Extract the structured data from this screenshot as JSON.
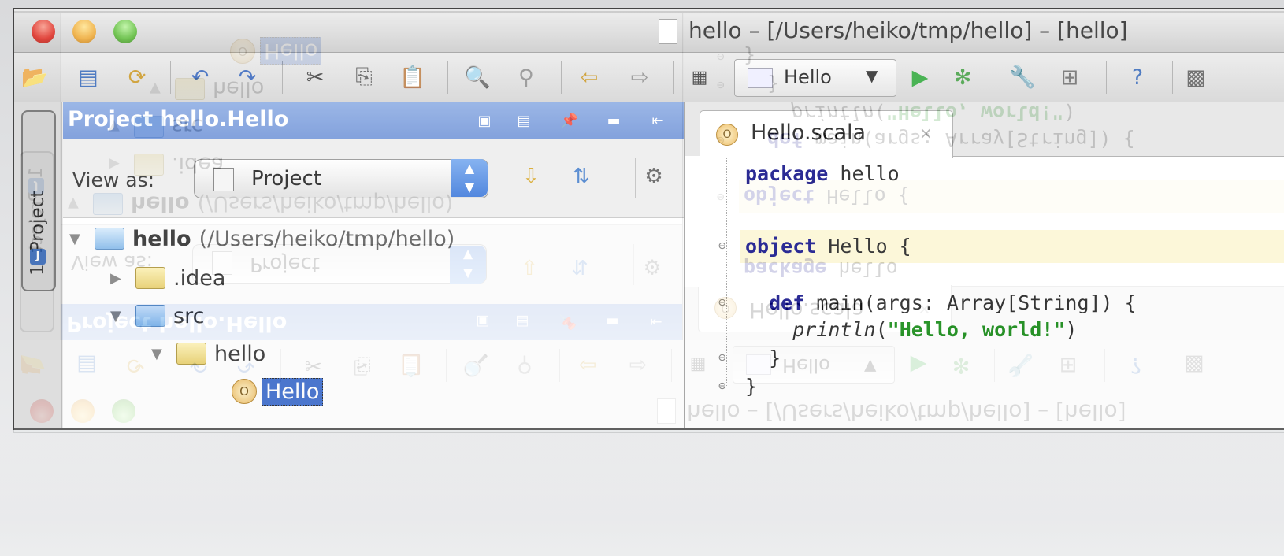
{
  "window": {
    "title": "hello – [/Users/heiko/tmp/hello] – [hello]"
  },
  "toolbar": {
    "icons": [
      "open-folder-icon",
      "save-icon",
      "sync-icon",
      "undo-icon",
      "redo-icon",
      "cut-icon",
      "copy-icon",
      "paste-icon",
      "find-icon",
      "replace-icon",
      "back-icon",
      "forward-icon",
      "compile-icon",
      "run-icon",
      "debug-icon",
      "settings-icon",
      "structure-icon",
      "help-icon",
      "sdk-icon"
    ],
    "run_config": "Hello"
  },
  "side_tab": {
    "label": "1: Project",
    "accent": "#2c62b6"
  },
  "project_panel": {
    "header": "Project hello.Hello",
    "view_as_label": "View as:",
    "view_as_value": "Project",
    "header_color": "#6a8fd6",
    "tree": [
      {
        "label": "hello",
        "detail": "(/Users/heiko/tmp/hello)",
        "expanded": true
      },
      {
        "label": ".idea",
        "expanded": false
      },
      {
        "label": "src",
        "expanded": true
      },
      {
        "label": "hello",
        "expanded": true
      },
      {
        "label": "Hello",
        "selected": true,
        "badge": "O"
      }
    ]
  },
  "editor": {
    "tab_label": "Hello.scala",
    "tab_badge": "O",
    "tab_close": "×",
    "code": {
      "line1_kw": "package",
      "line1_rest": " hello",
      "line3_kw": "object",
      "line3_rest": " Hello {",
      "line5_pre": "  ",
      "line5_kw": "def",
      "line5_rest": " main(args: Array[String]) {",
      "line6_pre": "    ",
      "line6_fn": "println",
      "line6_open": "(",
      "line6_str": "\"Hello, world!\"",
      "line6_close": ")",
      "line7": "  }",
      "line8": "}"
    },
    "highlight_color": "#fcf6d2"
  }
}
